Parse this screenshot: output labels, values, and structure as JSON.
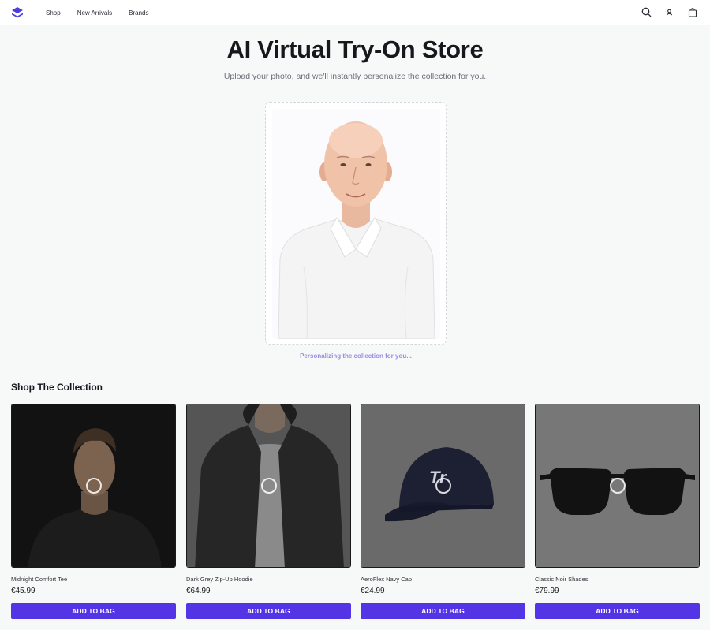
{
  "nav": {
    "items": [
      {
        "label": "Shop"
      },
      {
        "label": "New Arrivals"
      },
      {
        "label": "Brands"
      }
    ]
  },
  "header_icons": [
    "search-icon",
    "user-icon",
    "bag-icon"
  ],
  "hero": {
    "title": "AI Virtual Try-On Store",
    "subtitle": "Upload your photo, and we'll instantly personalize the collection for you.",
    "status": "Personalizing the collection for you..."
  },
  "collection": {
    "title": "Shop The Collection",
    "products": [
      {
        "name": "Midnight Comfort Tee",
        "price": "€45.99",
        "button": "ADD TO BAG"
      },
      {
        "name": "Dark Grey Zip-Up Hoodie",
        "price": "€64.99",
        "button": "ADD TO BAG"
      },
      {
        "name": "AeroFlex Navy Cap",
        "price": "€24.99",
        "button": "ADD TO BAG"
      },
      {
        "name": "Classic Noir Shades",
        "price": "€79.99",
        "button": "ADD TO BAG"
      }
    ]
  },
  "colors": {
    "accent": "#5335e5",
    "status_text": "#9b8ce6",
    "background": "#f7f8f8"
  }
}
